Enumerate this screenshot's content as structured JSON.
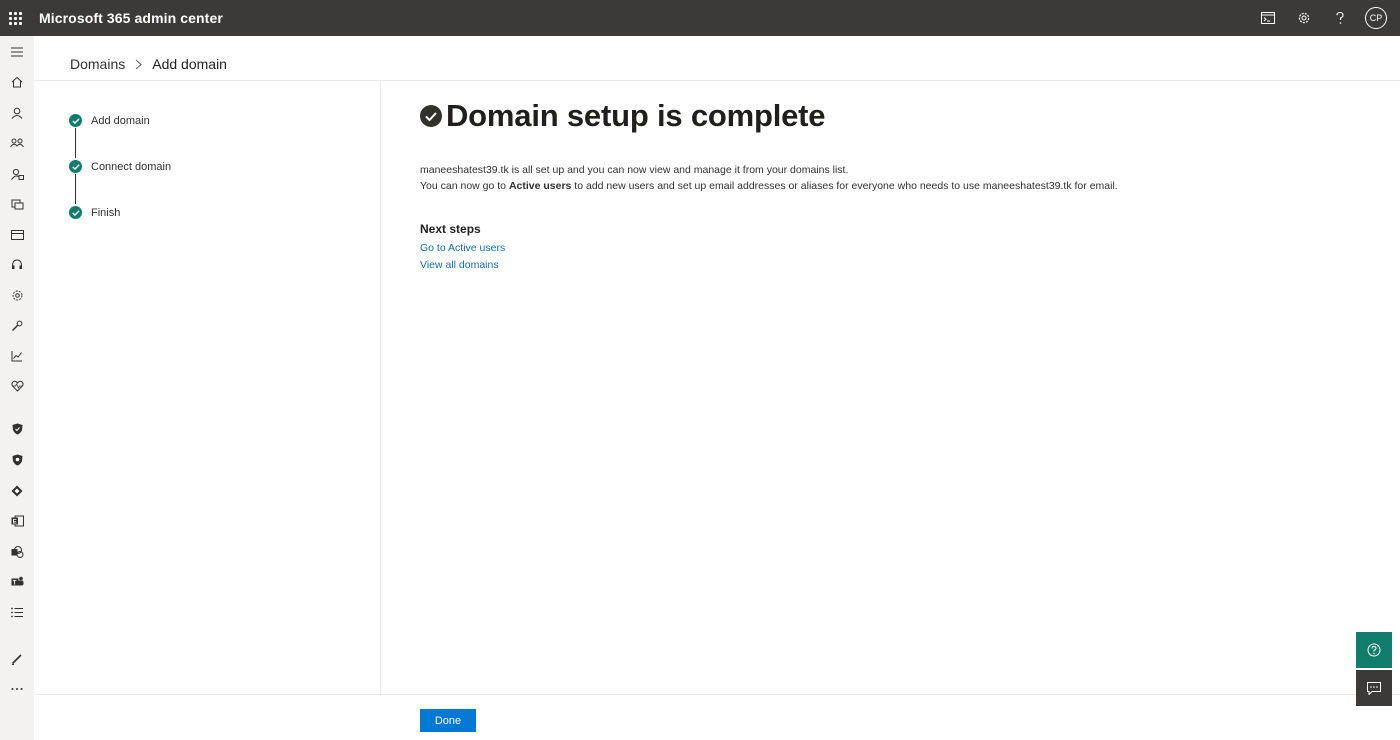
{
  "header": {
    "app_title": "Microsoft 365 admin center",
    "avatar_initials": "CP",
    "background": "#3b3a39"
  },
  "left_rail": {
    "icons": [
      "menu-icon",
      "home-icon",
      "user-icon",
      "teams-groups-icon",
      "roles-icon",
      "resources-icon",
      "billing-icon",
      "support-icon",
      "settings-icon",
      "setup-icon",
      "reports-icon",
      "health-icon",
      "security-icon",
      "compliance-icon",
      "endpoint-manager-icon",
      "exchange-icon",
      "sharepoint-icon",
      "teams-icon",
      "all-admin-centers-icon",
      "customize-icon",
      "more-icon"
    ]
  },
  "breadcrumb": {
    "parent": "Domains",
    "current": "Add domain"
  },
  "steps": [
    {
      "label": "Add domain",
      "status": "complete"
    },
    {
      "label": "Connect domain",
      "status": "complete"
    },
    {
      "label": "Finish",
      "status": "complete"
    }
  ],
  "main": {
    "title": "Domain setup is complete",
    "line1": "maneeshatest39.tk is all set up and you can now view and manage it from your domains list.",
    "line2_prefix": "You can now go to ",
    "line2_bold": "Active users",
    "line2_suffix": " to add new users and set up email addresses or aliases for everyone who needs to use maneeshatest39.tk for email.",
    "next_steps_title": "Next steps",
    "links": [
      "Go to Active users",
      "View all domains"
    ]
  },
  "footer": {
    "done_label": "Done"
  },
  "colors": {
    "accent": "#0078d4",
    "success": "#107c6c",
    "link": "#106ebe"
  }
}
